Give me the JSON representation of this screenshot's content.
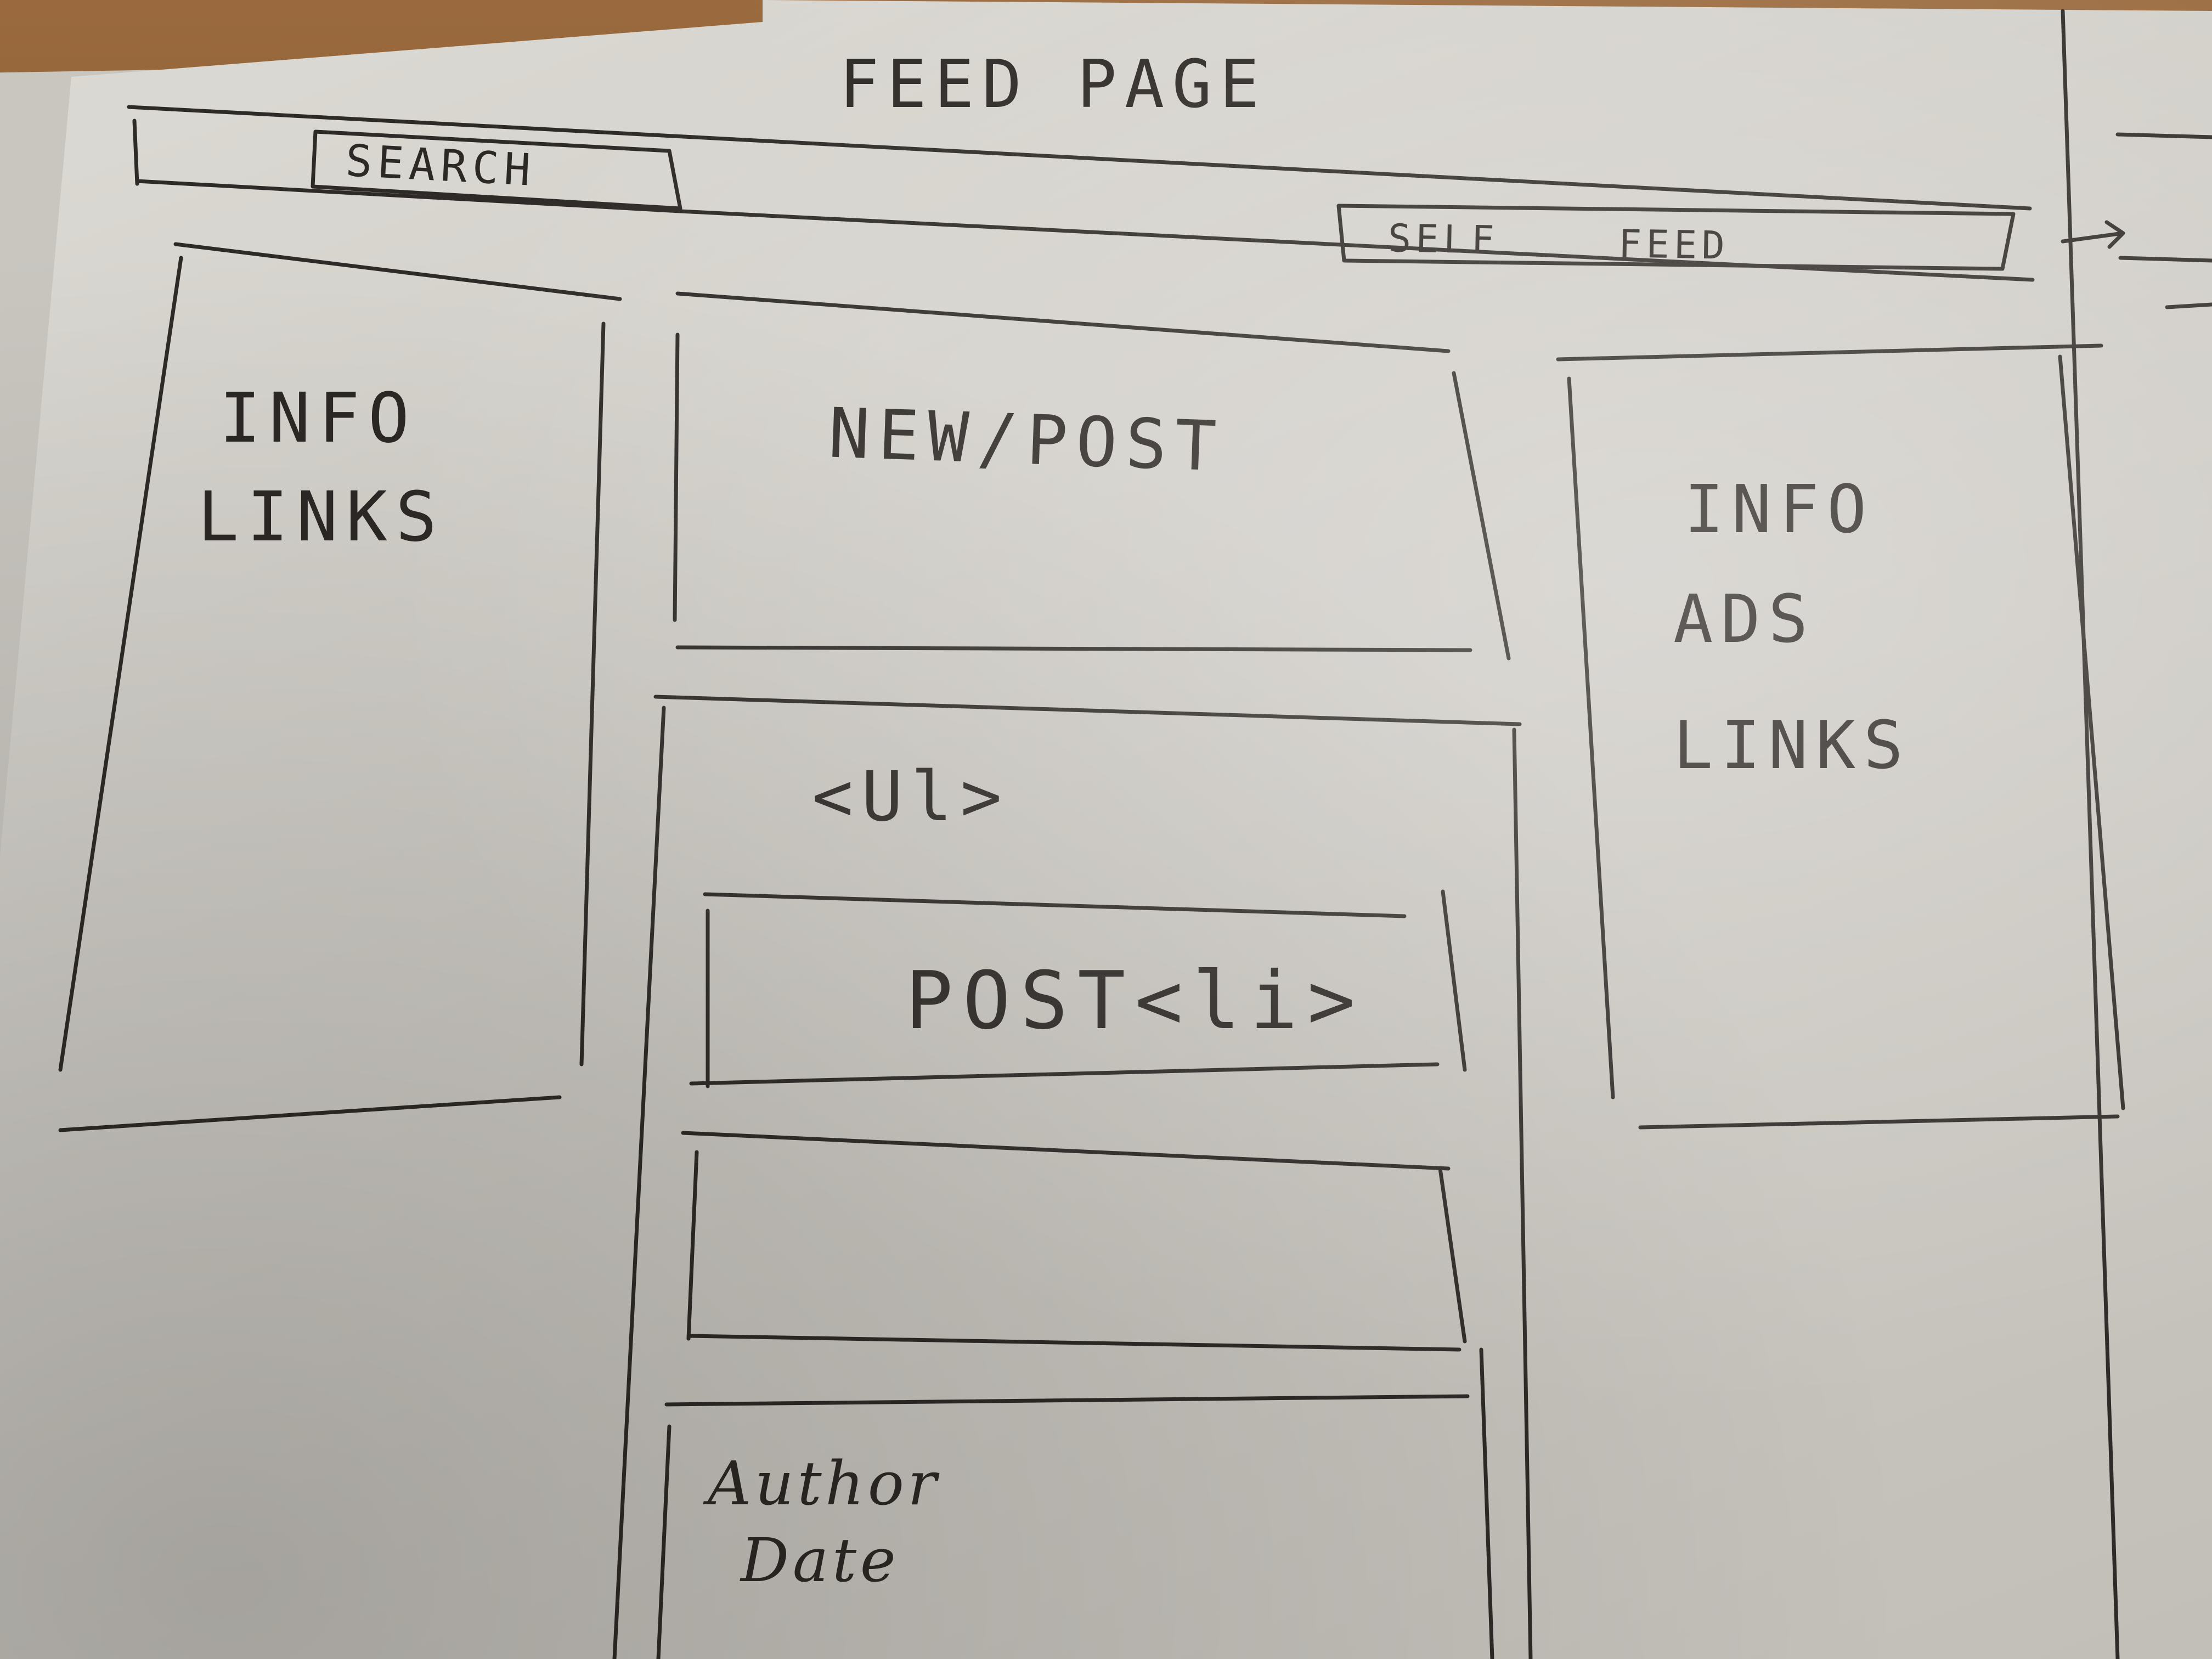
{
  "title": "FEED PAGE",
  "header": {
    "search_label": "SEARCH",
    "nav": {
      "self_label": "SELF",
      "feed_label": "FEED"
    }
  },
  "left_sidebar": {
    "line1": "INFO",
    "line2": "LINKS"
  },
  "new_post": {
    "label": "NEW/POST"
  },
  "feed_list": {
    "list_tag": "<Ul>",
    "items": [
      {
        "label": "POST<li>"
      },
      {
        "label": ""
      },
      {
        "line1": "Author",
        "line2": "Date"
      }
    ]
  },
  "right_sidebar": {
    "line1": "INFO",
    "line2": "ADS",
    "line3": "LINKS"
  },
  "colors": {
    "ink": "#2e2a27",
    "paper": "#d6d3cd",
    "wood": "#8a5a33"
  }
}
